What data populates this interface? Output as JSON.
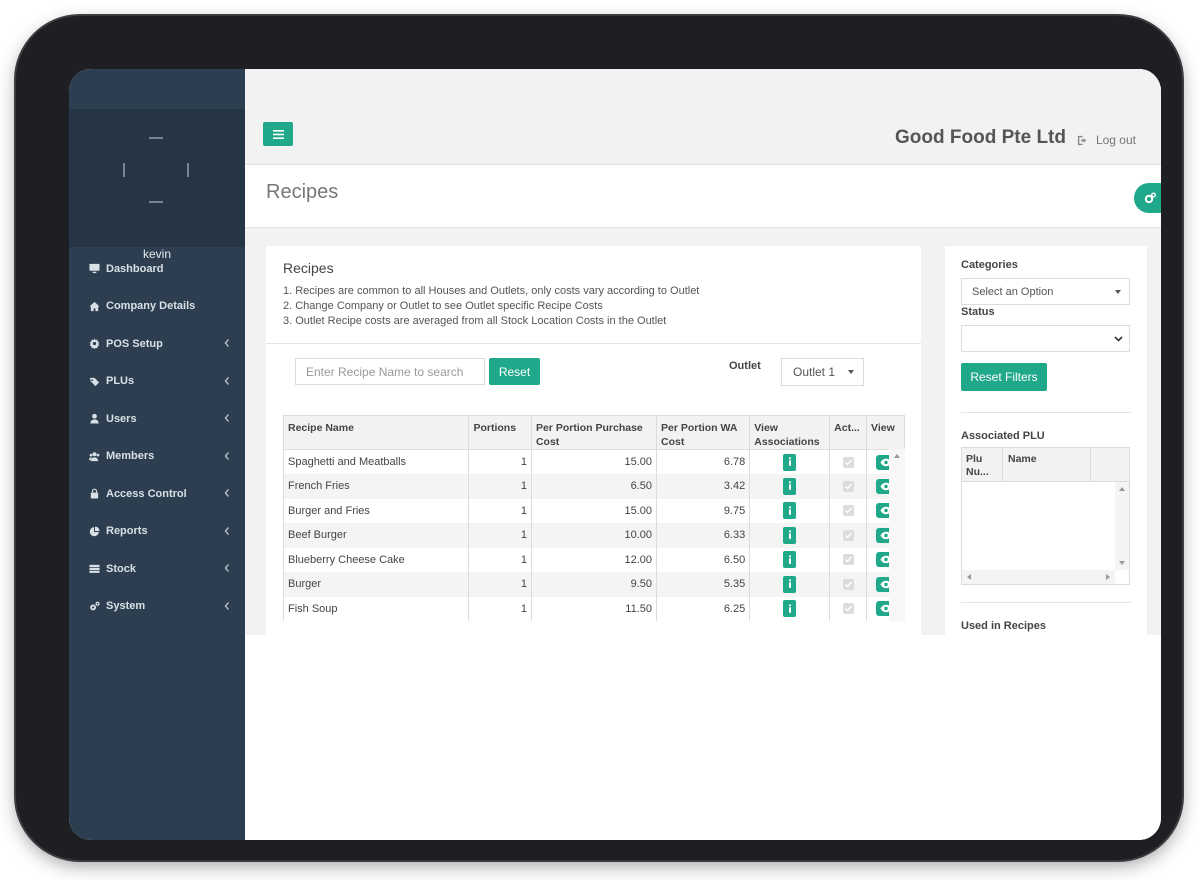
{
  "sidebar": {
    "username": "kevin",
    "items": [
      {
        "label": "Dashboard",
        "icon": "monitor-icon",
        "has_submenu": false
      },
      {
        "label": "Company Details",
        "icon": "home-icon",
        "has_submenu": false
      },
      {
        "label": "POS Setup",
        "icon": "gear-icon",
        "has_submenu": true
      },
      {
        "label": "PLUs",
        "icon": "tag-icon",
        "has_submenu": true
      },
      {
        "label": "Users",
        "icon": "user-icon",
        "has_submenu": true
      },
      {
        "label": "Members",
        "icon": "users-icon",
        "has_submenu": true
      },
      {
        "label": "Access Control",
        "icon": "lock-icon",
        "has_submenu": true
      },
      {
        "label": "Reports",
        "icon": "pie-chart-icon",
        "has_submenu": true
      },
      {
        "label": "Stock",
        "icon": "stock-icon",
        "has_submenu": true
      },
      {
        "label": "System",
        "icon": "cogs-icon",
        "has_submenu": true
      }
    ]
  },
  "header": {
    "company": "Good Food Pte Ltd",
    "logout_label": "Log out"
  },
  "page": {
    "title": "Recipes"
  },
  "recipes_panel": {
    "title": "Recipes",
    "notes": [
      "1. Recipes are common to all Houses and Outlets, only costs vary according to Outlet",
      "2. Change Company or Outlet to see Outlet specific Recipe Costs",
      "3. Outlet Recipe costs are averaged from all Stock Location Costs in the Outlet"
    ],
    "search_placeholder": "Enter Recipe Name to search",
    "reset_label": "Reset",
    "outlet_label": "Outlet",
    "outlet_value": "Outlet 1"
  },
  "table": {
    "columns": [
      "Recipe Name",
      "Portions",
      "Per Portion Purchase Cost",
      "Per Portion WA Cost",
      "View Associations",
      "Act...",
      "View"
    ],
    "rows": [
      {
        "name": "Spaghetti and Meatballs",
        "portions": "1",
        "purchase": "15.00",
        "wa": "6.78",
        "active": true
      },
      {
        "name": "French Fries",
        "portions": "1",
        "purchase": "6.50",
        "wa": "3.42",
        "active": true
      },
      {
        "name": "Burger and Fries",
        "portions": "1",
        "purchase": "15.00",
        "wa": "9.75",
        "active": true
      },
      {
        "name": "Beef Burger",
        "portions": "1",
        "purchase": "10.00",
        "wa": "6.33",
        "active": true
      },
      {
        "name": "Blueberry Cheese Cake",
        "portions": "1",
        "purchase": "12.00",
        "wa": "6.50",
        "active": true
      },
      {
        "name": "Burger",
        "portions": "1",
        "purchase": "9.50",
        "wa": "5.35",
        "active": true
      },
      {
        "name": "Fish Soup",
        "portions": "1",
        "purchase": "11.50",
        "wa": "6.25",
        "active": true
      }
    ]
  },
  "filters": {
    "categories_label": "Categories",
    "categories_placeholder": "Select an Option",
    "status_label": "Status",
    "status_value": "",
    "reset_filters_label": "Reset Filters",
    "associated_plu_label": "Associated PLU",
    "plu_columns": [
      "Plu Nu...",
      "Name"
    ],
    "used_in_recipes_label": "Used in Recipes"
  },
  "colors": {
    "accent": "#1fa88a",
    "sidebar": "#2c3e50"
  }
}
